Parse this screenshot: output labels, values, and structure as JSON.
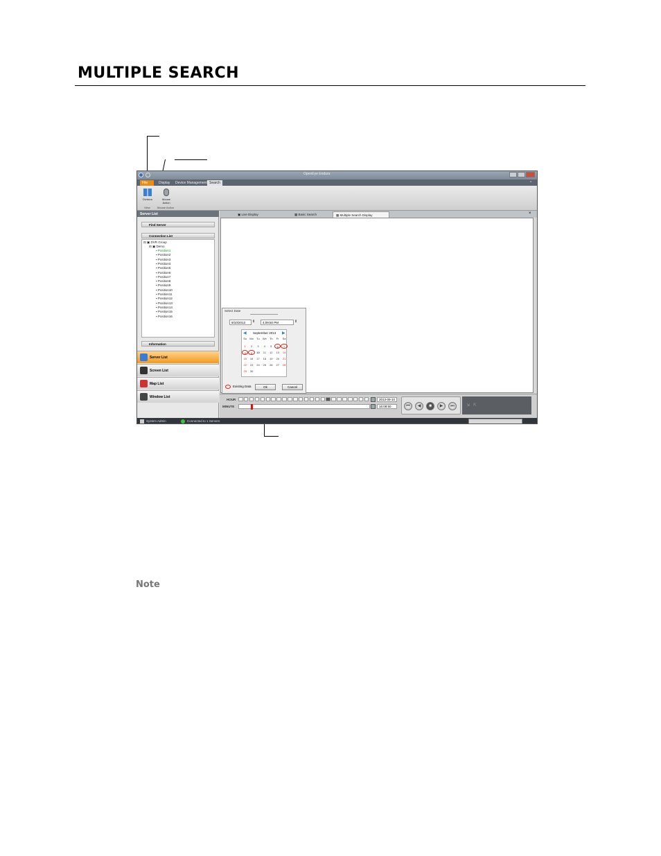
{
  "page": {
    "heading": "MULTIPLE SEARCH",
    "note_label": "Note"
  },
  "app": {
    "title": "OpenEye Endura",
    "menu": [
      "File",
      "Display",
      "Device Management",
      "Search"
    ],
    "ribbon": {
      "buttons": [
        {
          "label": "Division",
          "icon": "division-grid-icon"
        },
        {
          "label": "Mouse Action",
          "icon": "mouse-icon"
        }
      ],
      "groups": [
        "View",
        "Mouse Action"
      ]
    },
    "sidebar": {
      "panel_title": "Server List",
      "find_server": "Find Server",
      "connection_list": "Connection List",
      "tree": {
        "group": "DVR Group",
        "device": "Demo",
        "positions": [
          "Position1",
          "Position2",
          "Position3",
          "Position4",
          "Position5",
          "Position6",
          "Position7",
          "Position8",
          "Position9",
          "Position10",
          "Position11",
          "Position12",
          "Position13",
          "Position14",
          "Position15",
          "Position16"
        ]
      },
      "information": "Information",
      "nav": [
        {
          "label": "Server List",
          "icon": "server-list-icon",
          "active": true
        },
        {
          "label": "Screen List",
          "icon": "camera-icon",
          "active": false
        },
        {
          "label": "Map List",
          "icon": "map-icon",
          "active": false
        },
        {
          "label": "Window List",
          "icon": "window-icon",
          "active": false
        }
      ]
    },
    "tabs": [
      "Live Display",
      "Basic Search",
      "Multiple Search Display"
    ],
    "active_tab": "Multiple Search Display",
    "select_date": {
      "title": "Select Date",
      "date_value": "9/10/2013",
      "time_value": "4:09:50 PM",
      "month": "September 2013",
      "weekdays": [
        "Su",
        "Mo",
        "Tu",
        "We",
        "Th",
        "Fr",
        "Sa"
      ],
      "weeks": [
        [
          "1",
          "2",
          "3",
          "4",
          "5",
          "6",
          "7"
        ],
        [
          "8",
          "9",
          "10",
          "11",
          "12",
          "13",
          "14"
        ],
        [
          "15",
          "16",
          "17",
          "18",
          "19",
          "20",
          "21"
        ],
        [
          "22",
          "23",
          "24",
          "25",
          "26",
          "27",
          "28"
        ],
        [
          "29",
          "30",
          "",
          "",
          "",
          "",
          ""
        ]
      ],
      "legend": "Existing Data",
      "ok": "Ok",
      "cancel": "Cancel"
    },
    "timeline": {
      "hour_label": "HOUR",
      "minute_label": "MINUTE",
      "date_readout": "2013-09-10",
      "time_readout": "16:08:50"
    },
    "status": {
      "user": "System Admin",
      "connection": "Connected to 1 Servers"
    }
  }
}
